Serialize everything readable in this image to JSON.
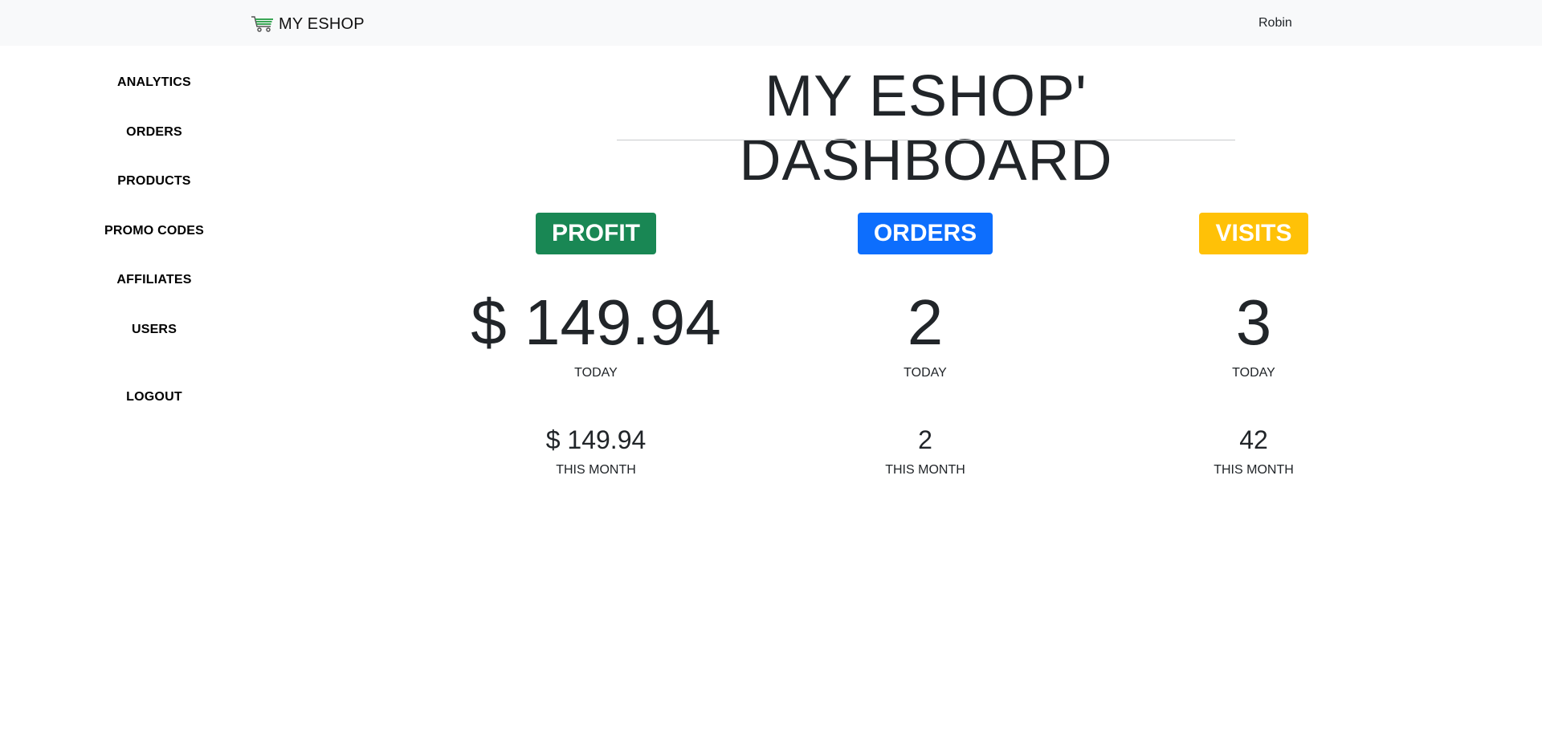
{
  "header": {
    "brand": "MY ESHOP",
    "brand_icon": "shopping-cart-icon",
    "user": "Robin"
  },
  "sidebar": {
    "items": [
      {
        "label": "ANALYTICS"
      },
      {
        "label": "ORDERS"
      },
      {
        "label": "PRODUCTS"
      },
      {
        "label": "PROMO CODES"
      },
      {
        "label": "AFFILIATES"
      },
      {
        "label": "USERS"
      }
    ],
    "logout": "LOGOUT"
  },
  "main": {
    "title": "MY ESHOP' DASHBOARD",
    "stats": [
      {
        "badge": "PROFIT",
        "color": "#198754",
        "today_value": "$ 149.94",
        "today_label": "TODAY",
        "month_value": "$ 149.94",
        "month_label": "THIS MONTH"
      },
      {
        "badge": "ORDERS",
        "color": "#0d6efd",
        "today_value": "2",
        "today_label": "TODAY",
        "month_value": "2",
        "month_label": "THIS MONTH"
      },
      {
        "badge": "VISITS",
        "color": "#ffc107",
        "today_value": "3",
        "today_label": "TODAY",
        "month_value": "42",
        "month_label": "THIS MONTH"
      }
    ]
  },
  "colors": {
    "navbar_bg": "#f8f9fa",
    "cart_icon": "#3aa655"
  }
}
